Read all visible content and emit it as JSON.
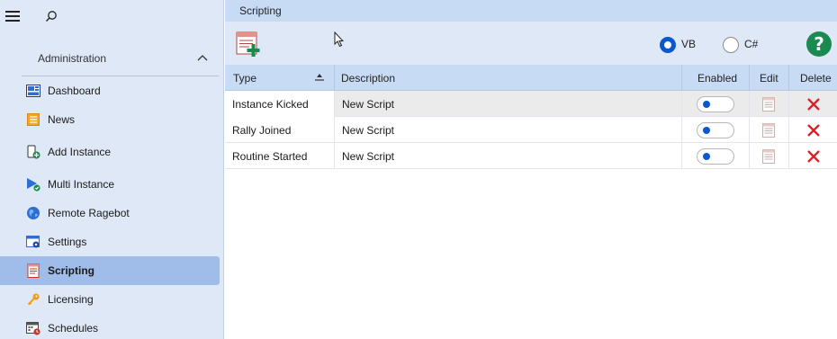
{
  "sidebar": {
    "section_title": "Administration",
    "items": [
      {
        "label": "Dashboard",
        "icon": "dashboard-icon"
      },
      {
        "label": "News",
        "icon": "news-icon"
      },
      {
        "label": "Add Instance",
        "icon": "add-instance-icon"
      },
      {
        "label": "Multi Instance",
        "icon": "multi-instance-icon"
      },
      {
        "label": "Remote Ragebot",
        "icon": "globe-icon"
      },
      {
        "label": "Settings",
        "icon": "settings-window-icon"
      },
      {
        "label": "Scripting",
        "icon": "script-icon",
        "active": true
      },
      {
        "label": "Licensing",
        "icon": "key-icon"
      },
      {
        "label": "Schedules",
        "icon": "calendar-clock-icon"
      }
    ]
  },
  "main": {
    "title": "Scripting",
    "toolbar": {
      "language_options": [
        {
          "label": "VB",
          "selected": true
        },
        {
          "label": "C#",
          "selected": false
        }
      ],
      "help_label": "?"
    },
    "table": {
      "columns": [
        "Type",
        "Description",
        "Enabled",
        "Edit",
        "Delete"
      ],
      "rows": [
        {
          "type": "Instance Kicked",
          "description": "New Script",
          "enabled": false
        },
        {
          "type": "Rally Joined",
          "description": "New Script",
          "enabled": false
        },
        {
          "type": "Routine Started",
          "description": "New Script",
          "enabled": false
        }
      ]
    }
  },
  "colors": {
    "accent": "#0b57d0",
    "sidebar_bg": "#dfe8f6",
    "active_item": "#9fbde8",
    "delete_red": "#d9222a",
    "help_green": "#1a8a50"
  }
}
